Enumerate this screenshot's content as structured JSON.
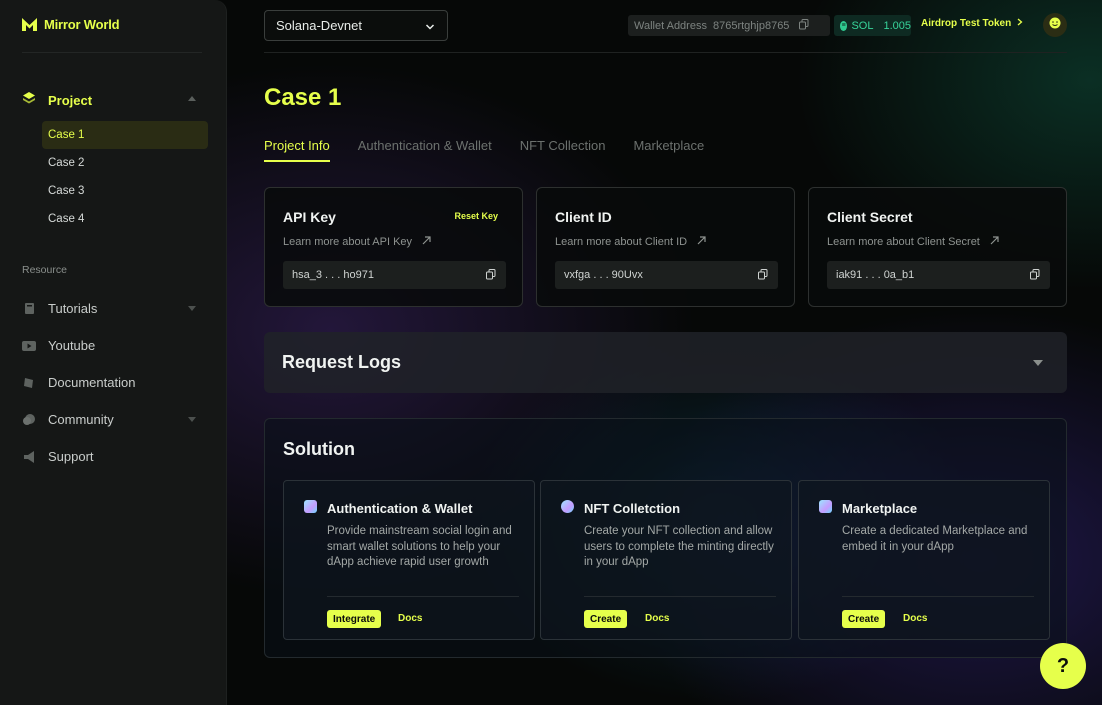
{
  "app": {
    "brand": "Mirror World"
  },
  "sidebar": {
    "project_label": "Project",
    "cases": [
      "Case 1",
      "Case 2",
      "Case 3",
      "Case 4"
    ],
    "active_case": "Case 1",
    "resource_label": "Resource",
    "resources": [
      {
        "label": "Tutorials",
        "icon": "book-icon",
        "expandable": true
      },
      {
        "label": "Youtube",
        "icon": "youtube-icon",
        "expandable": false
      },
      {
        "label": "Documentation",
        "icon": "document-icon",
        "expandable": false
      },
      {
        "label": "Community",
        "icon": "chat-icon",
        "expandable": true
      },
      {
        "label": "Support",
        "icon": "megaphone-icon",
        "expandable": false
      }
    ]
  },
  "topbar": {
    "network": "Solana-Devnet",
    "wallet_label": "Wallet Address",
    "wallet_address": "8765rtghjp8765",
    "sol_label": "SOL",
    "sol_amount": "1.005",
    "airdrop_label": "Airdrop Test Token"
  },
  "page": {
    "title": "Case 1",
    "tabs": [
      "Project Info",
      "Authentication & Wallet",
      "NFT Collection",
      "Marketplace"
    ],
    "active_tab": "Project Info"
  },
  "keys": [
    {
      "title": "API Key",
      "action": "Reset Key",
      "learn": "Learn more about API Key",
      "value": "hsa_3 . . . ho971"
    },
    {
      "title": "Client ID",
      "action": "",
      "learn": "Learn more about Client ID",
      "value": "vxfga . . . 90Uvx"
    },
    {
      "title": "Client Secret",
      "action": "",
      "learn": "Learn more about Client Secret",
      "value": "iak91 . . . 0a_b1"
    }
  ],
  "request_logs": {
    "title": "Request Logs"
  },
  "solution": {
    "title": "Solution",
    "cards": [
      {
        "name": "Authentication & Wallet",
        "desc": "Provide mainstream social login and smart wallet solutions to help your dApp achieve rapid user growth",
        "button": "Integrate",
        "docs": "Docs"
      },
      {
        "name": "NFT Colletction",
        "desc": "Create your NFT collection and allow users to complete the minting directly in your dApp",
        "button": "Create",
        "docs": "Docs"
      },
      {
        "name": "Marketplace",
        "desc": "Create a dedicated Marketplace and embed it in your dApp",
        "button": "Create",
        "docs": "Docs"
      }
    ]
  },
  "help": {
    "label": "?"
  },
  "colors": {
    "accent": "#e6ff4b",
    "sol_green": "#2fc98f",
    "background": "#060807",
    "sidebar": "#151716"
  }
}
